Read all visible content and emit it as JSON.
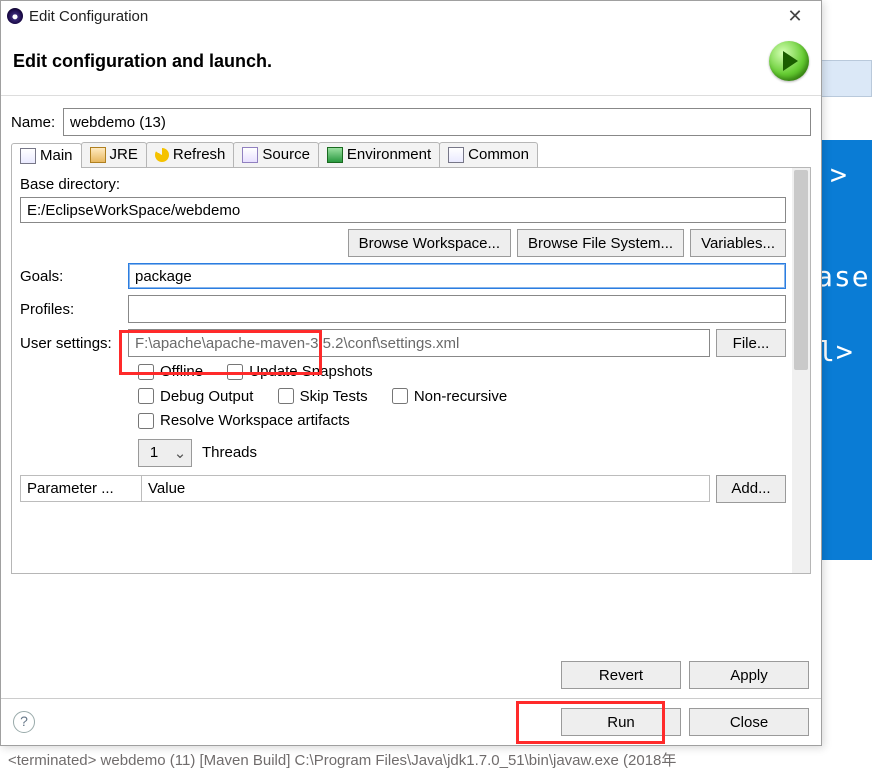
{
  "window": {
    "title": "Edit Configuration"
  },
  "header": {
    "heading": "Edit configuration and launch."
  },
  "name_field": {
    "label": "Name:",
    "value": "webdemo (13)"
  },
  "tabs": {
    "main": "Main",
    "jre": "JRE",
    "refresh": "Refresh",
    "source": "Source",
    "environment": "Environment",
    "common": "Common"
  },
  "main_tab": {
    "base_dir_label": "Base directory:",
    "base_dir_value": "E:/EclipseWorkSpace/webdemo",
    "browse_ws": "Browse Workspace...",
    "browse_fs": "Browse File System...",
    "variables": "Variables...",
    "goals_label": "Goals:",
    "goals_value": "package",
    "profiles_label": "Profiles:",
    "profiles_value": "",
    "user_settings_label": "User settings:",
    "user_settings_value": "F:\\apache\\apache-maven-3.5.2\\conf\\settings.xml",
    "file_btn": "File...",
    "offline": "Offline",
    "update_snapshots": "Update Snapshots",
    "debug_output": "Debug Output",
    "skip_tests": "Skip Tests",
    "non_recursive": "Non-recursive",
    "resolve_ws": "Resolve Workspace artifacts",
    "threads_value": "1",
    "threads_label": "Threads",
    "param_header": "Parameter ...",
    "value_header": "Value",
    "add_btn": "Add..."
  },
  "actions": {
    "revert": "Revert",
    "apply": "Apply",
    "run": "Run",
    "close": "Close"
  },
  "background": {
    "caret": ">",
    "frag1": "ase",
    "frag2": "l>",
    "console": "<terminated> webdemo (11) [Maven Build] C:\\Program Files\\Java\\jdk1.7.0_51\\bin\\javaw.exe (2018年"
  }
}
